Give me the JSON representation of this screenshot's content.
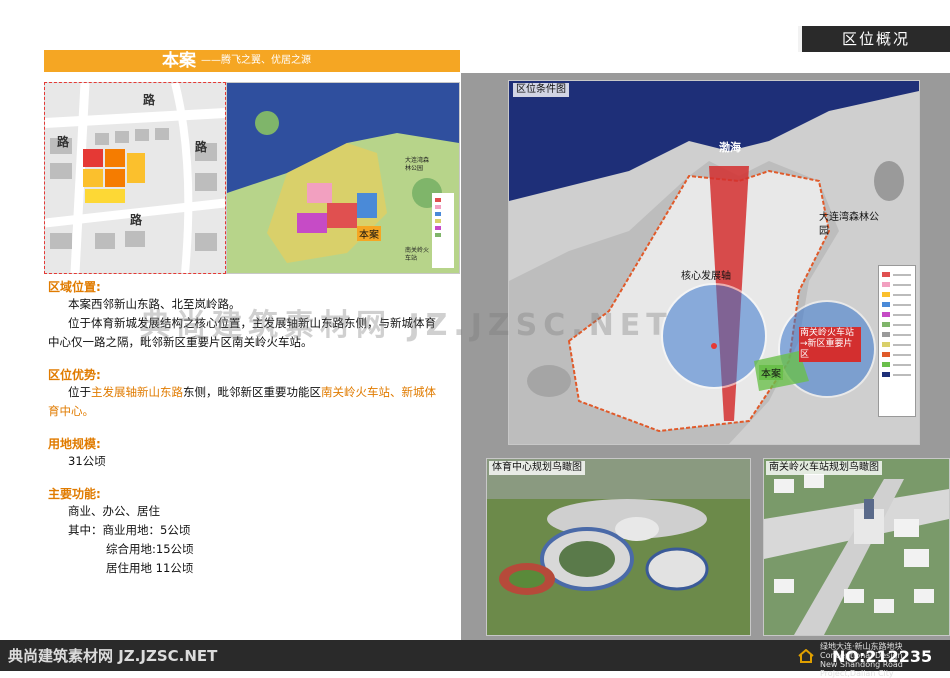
{
  "header": {
    "section_title": "区位概况",
    "banner_title": "本案",
    "banner_subtitle": "——腾飞之翼、优居之源"
  },
  "left_maps": {
    "road_labels": [
      "路",
      "路",
      "路",
      "路"
    ],
    "masterplan_tag": "本案",
    "masterplan_labels": [
      "大连湾森林公园",
      "南关岭火车站"
    ]
  },
  "sections": {
    "location_head": "区域位置:",
    "location_line1": "本案西邻新山东路、北至岚岭路。",
    "location_line2": "位于体育新城发展结构之核心位置，主发展轴新山东路东侧，与新城体育中心仅一路之隔，毗邻新区重要片区南关岭火车站。",
    "advantage_head": "区位优势:",
    "advantage_pre": "位于",
    "advantage_hl1": "主发展轴新山东路",
    "advantage_mid": "东侧，毗邻新区重要功能区",
    "advantage_hl2": "南关岭火车站、新城体育中心。",
    "scale_head": "用地规模:",
    "scale_value": "31公顷",
    "function_head": "主要功能:",
    "function_list": "商业、办公、居住",
    "function_detail1": "其中：商业用地：5公顷",
    "function_detail2": "综合用地:15公顷",
    "function_detail3": "居住用地 11公顷"
  },
  "main_map": {
    "caption": "区位条件图",
    "label_bohai": "渤海",
    "label_forest": "大连湾森林公园",
    "label_axis": "核心发展轴",
    "label_station": "南关岭火车站→新区重要片区",
    "label_project": "本案"
  },
  "bottom_images": {
    "caption_sports": "体育中心规划鸟瞰图",
    "caption_station": "南关岭火车站规划鸟瞰图"
  },
  "watermark": {
    "text": "典尚建筑素材网 JZ.JZSC.NET"
  },
  "footer": {
    "watermark": "典尚建筑素材网  JZ.JZSC.NET",
    "project_line1": "绿地大连·新山东路地块",
    "project_line2": "Conceptional Design",
    "project_line3": "New Shandong Road Project,Dalian City",
    "number": "NO:212235"
  },
  "colors": {
    "accent": "#f5a623",
    "highlight_text": "#e07b00",
    "dark": "#2a2a2a",
    "sea": "#1a2a6a"
  }
}
